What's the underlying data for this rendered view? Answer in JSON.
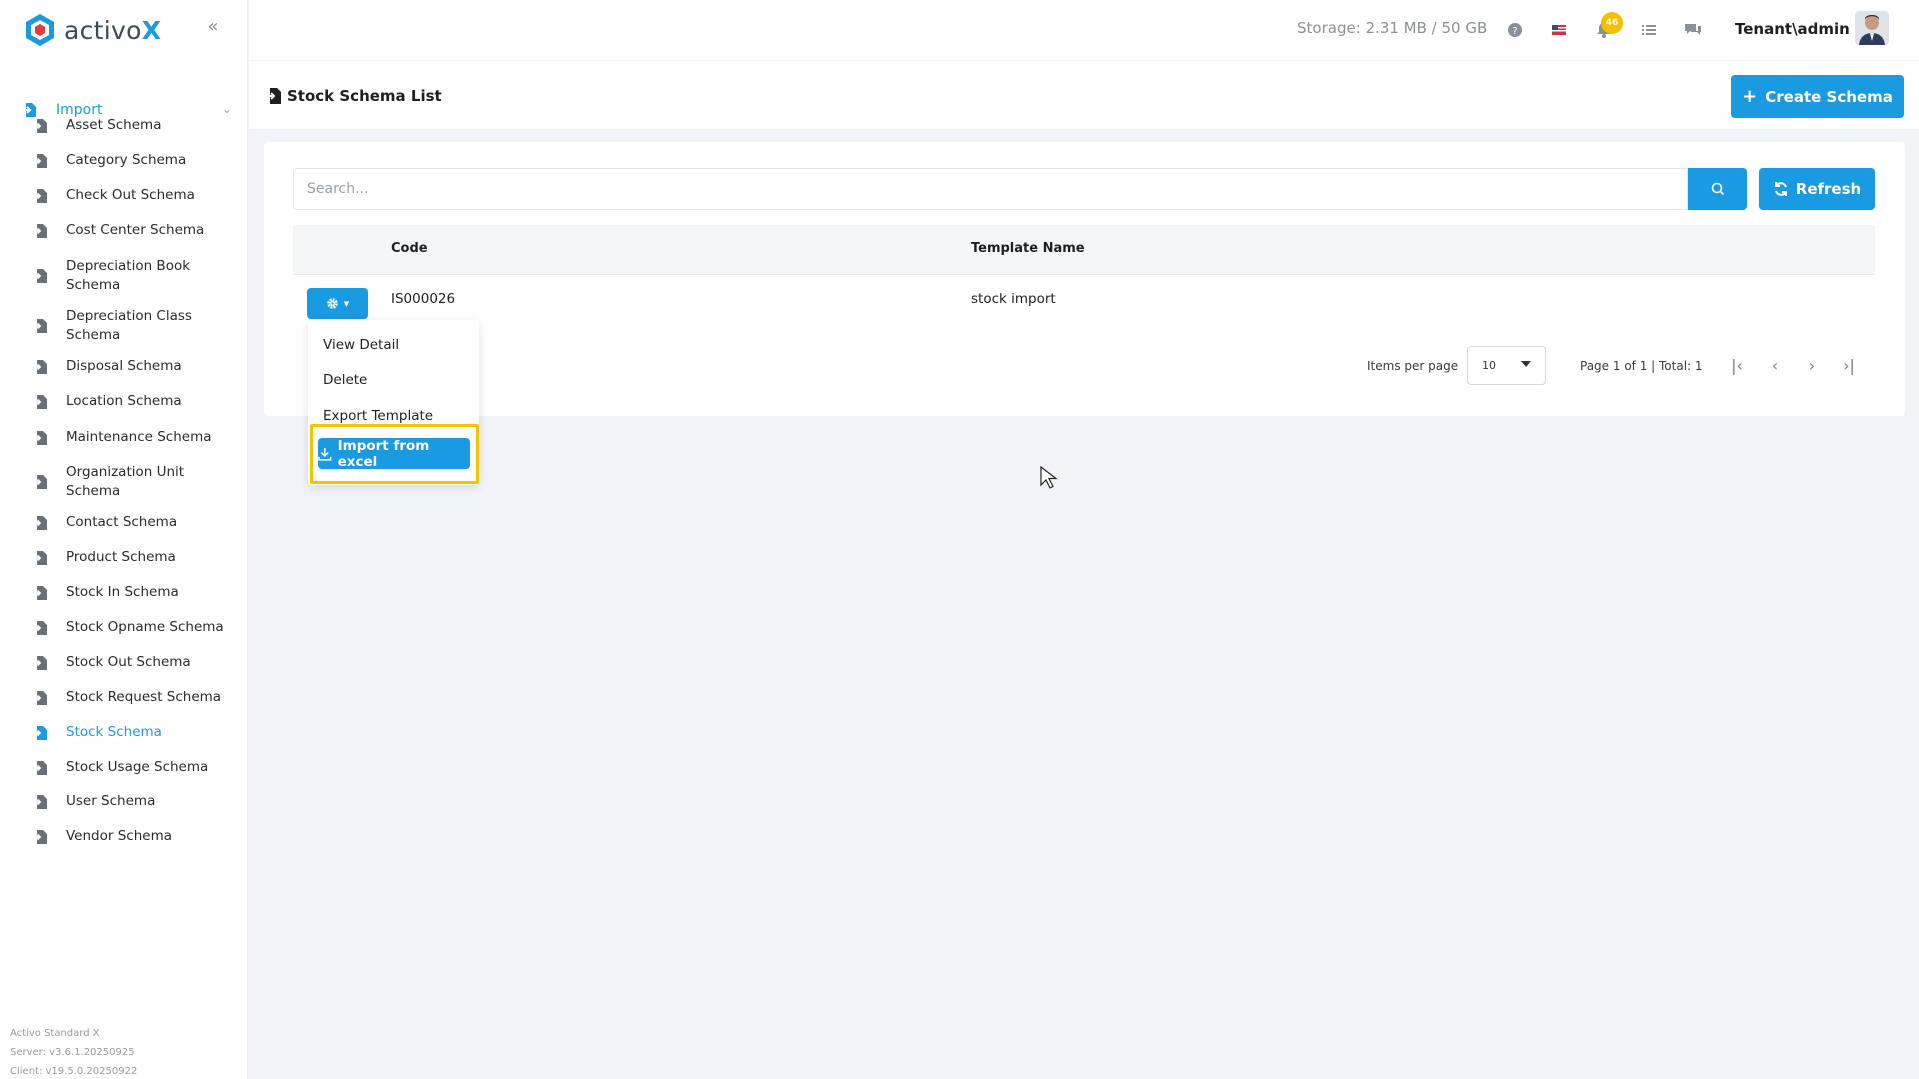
{
  "app": {
    "brand_prefix": "activo",
    "brand_suffix": "X"
  },
  "header": {
    "storage": "Storage: 2.31 MB / 50 GB",
    "notification_count": "46",
    "user": "Tenant\\admin"
  },
  "sidebar": {
    "group_label": "Import",
    "items": [
      {
        "label": "Asset Schema"
      },
      {
        "label": "Category Schema"
      },
      {
        "label": "Check Out Schema"
      },
      {
        "label": "Cost Center Schema"
      },
      {
        "label": "Depreciation Book Schema"
      },
      {
        "label": "Depreciation Class Schema"
      },
      {
        "label": "Disposal Schema"
      },
      {
        "label": "Location Schema"
      },
      {
        "label": "Maintenance Schema"
      },
      {
        "label": "Organization Unit Schema"
      },
      {
        "label": "Contact Schema"
      },
      {
        "label": "Product Schema"
      },
      {
        "label": "Stock In Schema"
      },
      {
        "label": "Stock Opname Schema"
      },
      {
        "label": "Stock Out Schema"
      },
      {
        "label": "Stock Request Schema"
      },
      {
        "label": "Stock Schema"
      },
      {
        "label": "Stock Usage Schema"
      },
      {
        "label": "User Schema"
      },
      {
        "label": "Vendor Schema"
      }
    ],
    "footer": {
      "product": "Activo Standard X",
      "server": "Server: v3.6.1.20250925",
      "client": "Client: v19.5.0.20250922"
    }
  },
  "page": {
    "title": "Stock Schema List",
    "create_label": "Create Schema",
    "search_placeholder": "Search...",
    "refresh_label": "Refresh"
  },
  "table": {
    "columns": [
      "Code",
      "Template Name"
    ],
    "rows": [
      {
        "code": "IS000026",
        "template_name": "stock import"
      }
    ]
  },
  "pagination": {
    "items_per_page_label": "Items per page",
    "items_per_page": "10",
    "page_info": "Page 1 of 1 | Total: 1"
  },
  "action_menu": {
    "items": [
      "View Detail",
      "Delete",
      "Export Template"
    ],
    "primary": "Import from excel"
  },
  "colors": {
    "accent": "#1a9ae0",
    "highlight": "#f5c400",
    "badge": "#f6c000"
  }
}
